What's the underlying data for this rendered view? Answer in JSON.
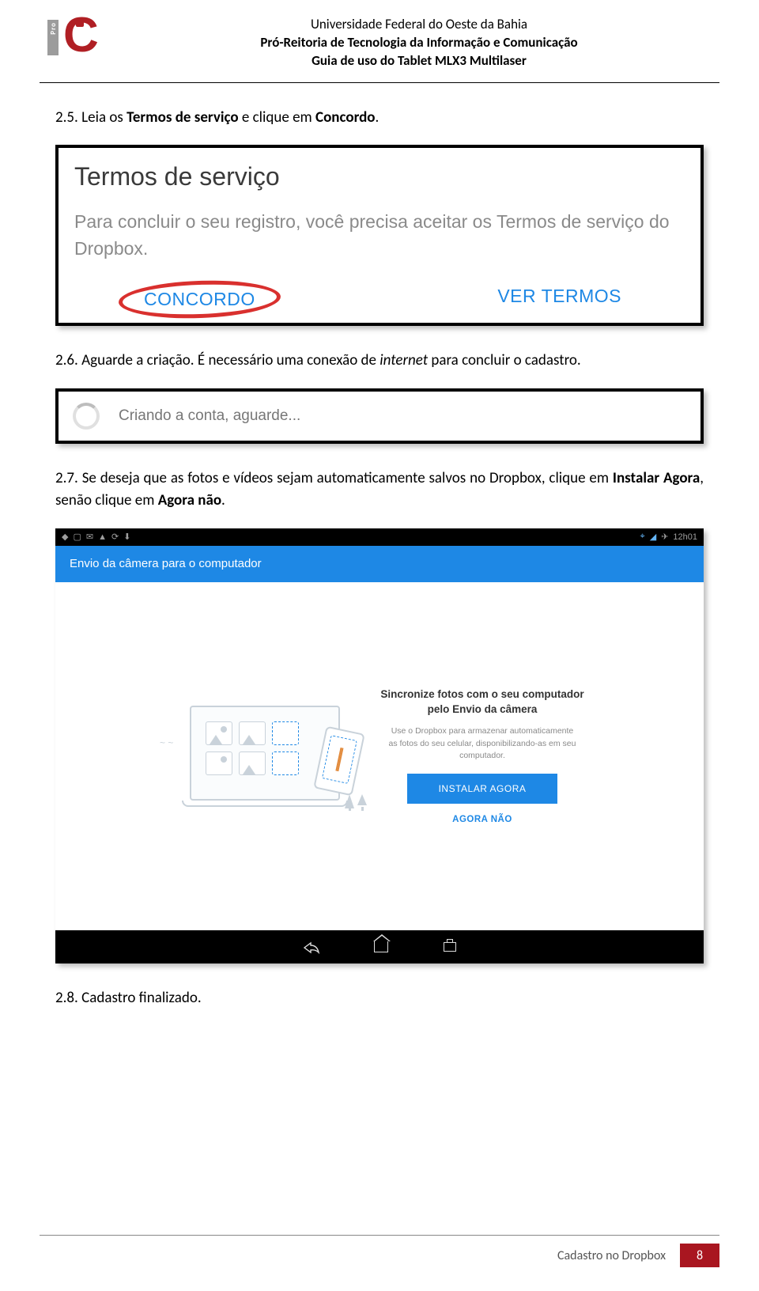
{
  "header": {
    "logo_text": "Pro",
    "line1": "Universidade Federal do Oeste da Bahia",
    "line2": "Pró-Reitoria de Tecnologia da Informação e Comunicação",
    "line3": "Guia de uso do Tablet MLX3 Multilaser"
  },
  "steps": {
    "s25_pre": "2.5.  Leia os ",
    "s25_b1": "Termos de serviço",
    "s25_mid": " e clique em ",
    "s25_b2": "Concordo",
    "s25_post": ".",
    "s26_pre": "2.6.  Aguarde a criação. É necessário uma conexão de ",
    "s26_i": "internet",
    "s26_post": " para concluir o cadastro.",
    "s27_pre": "2.7.  Se deseja que as fotos e vídeos sejam automaticamente salvos no Dropbox, clique em ",
    "s27_b1": "Instalar Agora",
    "s27_mid": ", senão clique em ",
    "s27_b2": "Agora não",
    "s27_post": ".",
    "s28": "2.8.  Cadastro finalizado."
  },
  "fig1": {
    "title": "Termos de serviço",
    "desc": "Para concluir o seu registro, você precisa aceitar os Termos de serviço do Dropbox.",
    "agree": "CONCORDO",
    "view": "VER TERMOS"
  },
  "fig2": {
    "text": "Criando a conta, aguarde..."
  },
  "fig3": {
    "time": "12h01",
    "appbar_title": "Envio da câmera para o computador",
    "promo_title": "Sincronize fotos com o seu computador pelo Envio da câmera",
    "promo_desc": "Use o Dropbox para armazenar automaticamente as fotos do seu celular, disponibilizando-as em seu computador.",
    "install": "INSTALAR AGORA",
    "skip": "AGORA NÃO"
  },
  "footer": {
    "label": "Cadastro no Dropbox",
    "page": "8"
  }
}
